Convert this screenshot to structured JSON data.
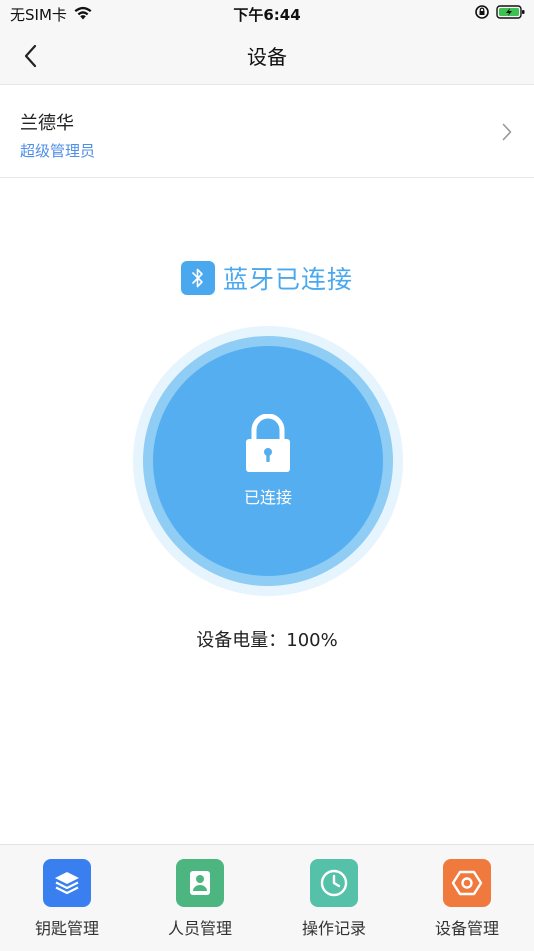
{
  "status_bar": {
    "carrier": "无SIM卡",
    "time": "下午6:44"
  },
  "nav": {
    "title": "设备"
  },
  "user": {
    "name": "兰德华",
    "role": "超级管理员"
  },
  "bluetooth": {
    "status_text": "蓝牙已连接"
  },
  "lock": {
    "label": "已连接"
  },
  "battery": {
    "text": "设备电量：100%"
  },
  "colors": {
    "accent": "#4aa8ee",
    "role_blue": "#4f8fe8",
    "tab_key": "#3a7ff0",
    "tab_people": "#4cb580",
    "tab_log": "#55c1a8",
    "tab_device": "#f07a3e"
  },
  "tabs": [
    {
      "label": "钥匙管理",
      "icon": "layers-icon"
    },
    {
      "label": "人员管理",
      "icon": "person-icon"
    },
    {
      "label": "操作记录",
      "icon": "clock-icon"
    },
    {
      "label": "设备管理",
      "icon": "hexagon-icon"
    }
  ]
}
